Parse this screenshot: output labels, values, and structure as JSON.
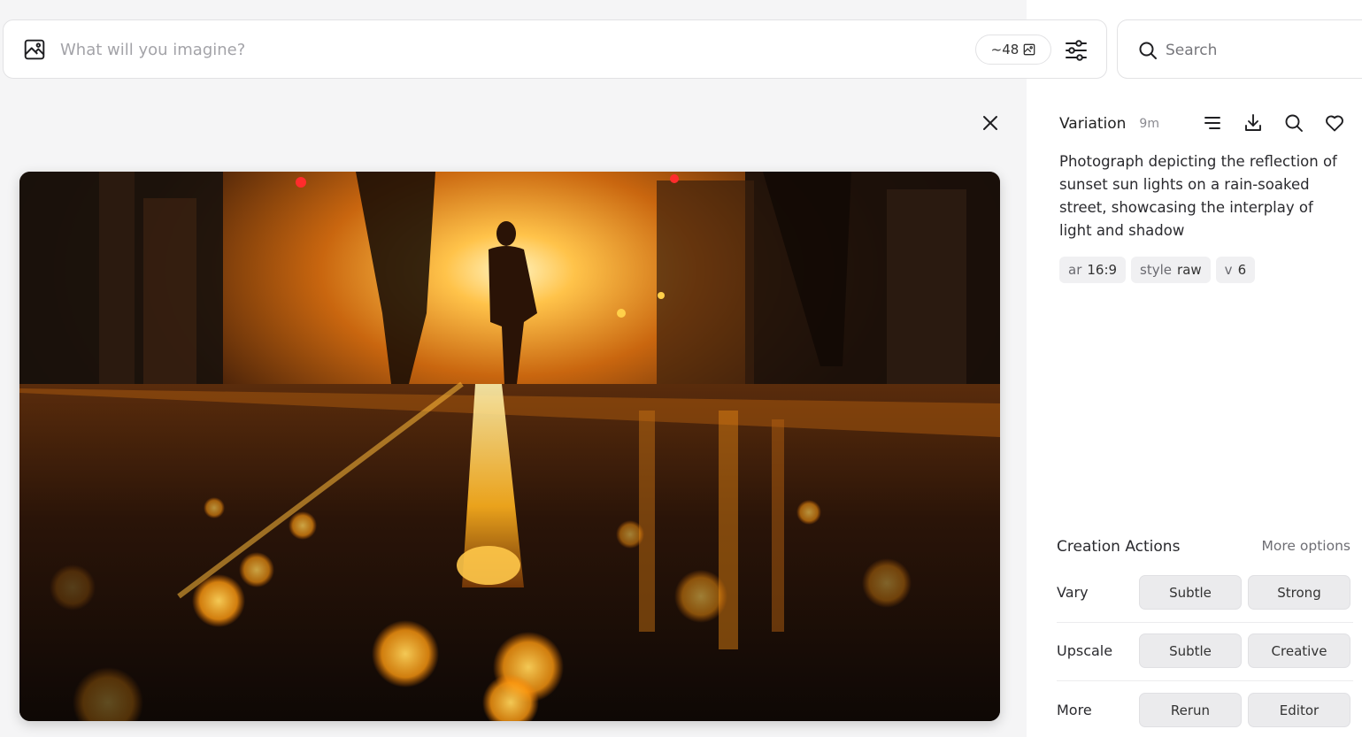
{
  "prompt_bar": {
    "placeholder": "What will you imagine?",
    "count_label": "~48",
    "image_icon": "image-icon",
    "settings_icon": "sliders-icon"
  },
  "search": {
    "placeholder": "Search",
    "icon": "search-icon"
  },
  "close_icon": "close-icon",
  "image": {
    "description_icon": "photo"
  },
  "detail": {
    "title": "Variation",
    "time": "9m",
    "icons": [
      "list-icon",
      "download-icon",
      "search-icon",
      "heart-icon"
    ],
    "prompt": "Photograph depicting the reflection of sunset sun lights on a rain-soaked street, showcasing the interplay of light and shadow",
    "params": [
      {
        "key": "ar",
        "value": "16:9"
      },
      {
        "key": "style",
        "value": "raw"
      },
      {
        "key": "v",
        "value": "6"
      }
    ]
  },
  "creation_actions": {
    "title": "Creation Actions",
    "more_options": "More options",
    "rows": [
      {
        "label": "Vary",
        "buttons": [
          "Subtle",
          "Strong"
        ]
      },
      {
        "label": "Upscale",
        "buttons": [
          "Subtle",
          "Creative"
        ]
      },
      {
        "label": "More",
        "buttons": [
          "Rerun",
          "Editor"
        ]
      }
    ]
  },
  "colors": {
    "background": "#f5f5f6",
    "panel": "#ffffff",
    "button": "#ebebed",
    "sunset": "#ffb02a"
  }
}
